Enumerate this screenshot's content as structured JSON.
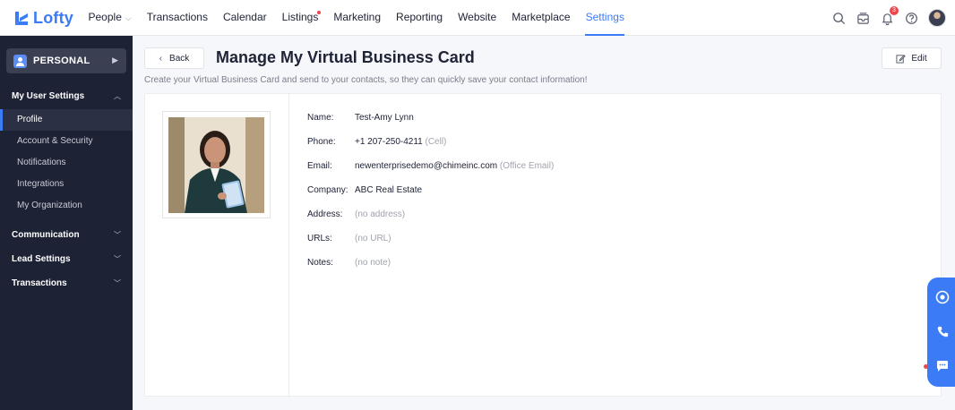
{
  "app": {
    "name": "Lofty",
    "brand_color": "#3b7bf6"
  },
  "nav": {
    "items": [
      {
        "label": "People",
        "has_caret": true
      },
      {
        "label": "Transactions"
      },
      {
        "label": "Calendar"
      },
      {
        "label": "Listings",
        "has_dot": true
      },
      {
        "label": "Marketing"
      },
      {
        "label": "Reporting"
      },
      {
        "label": "Website"
      },
      {
        "label": "Marketplace"
      },
      {
        "label": "Settings",
        "active": true
      }
    ],
    "notification_count": "3"
  },
  "sidebar": {
    "switcher_label": "PERSONAL",
    "sections": [
      {
        "label": "My User Settings",
        "expanded": true,
        "items": [
          "Profile",
          "Account & Security",
          "Notifications",
          "Integrations",
          "My Organization"
        ]
      },
      {
        "label": "Communication"
      },
      {
        "label": "Lead Settings"
      },
      {
        "label": "Transactions"
      }
    ],
    "active_item": "Profile"
  },
  "page": {
    "back_label": "Back",
    "title": "Manage My Virtual Business Card",
    "subtitle": "Create your Virtual Business Card and send to your contacts, so they can quickly save your contact information!",
    "edit_label": "Edit"
  },
  "card": {
    "fields": [
      {
        "label": "Name:",
        "value": "Test-Amy Lynn",
        "note": ""
      },
      {
        "label": "Phone:",
        "value": "+1 207-250-4211",
        "note": "(Cell)"
      },
      {
        "label": "Email:",
        "value": "newenterprisedemo@chimeinc.com",
        "note": "(Office Email)"
      },
      {
        "label": "Company:",
        "value": "ABC Real Estate",
        "note": ""
      },
      {
        "label": "Address:",
        "value": "",
        "note": "(no address)"
      },
      {
        "label": "URLs:",
        "value": "",
        "note": "(no URL)"
      },
      {
        "label": "Notes:",
        "value": "",
        "note": "(no note)"
      }
    ]
  }
}
